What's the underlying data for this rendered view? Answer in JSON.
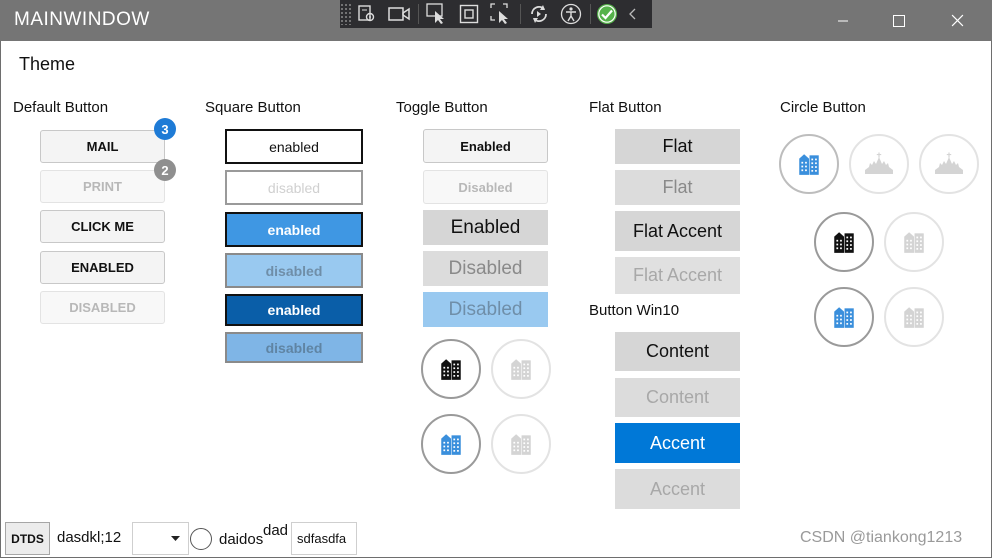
{
  "window": {
    "title": "MAINWINDOW",
    "controls": {
      "minimize": "—",
      "maximize": "☐",
      "close": "✕"
    }
  },
  "toolbar_icons": [
    "live-visual-tree-icon",
    "video-icon",
    "select-element-icon",
    "display-layout-adorners-icon",
    "track-focus-icon",
    "hot-reload-icon",
    "accessibility-icon",
    "binding-success-icon",
    "collapse-icon"
  ],
  "page": {
    "heading": "Theme"
  },
  "default_buttons": {
    "title": "Default Button",
    "mail": "MAIL",
    "mail_badge": "3",
    "print": "PRINT",
    "print_badge": "2",
    "click_me": "CLICK ME",
    "enabled": "ENABLED",
    "disabled": "DISABLED"
  },
  "square_buttons": {
    "title": "Square Button",
    "items": [
      "enabled",
      "disabled",
      "enabled",
      "disabled",
      "enabled",
      "disabled"
    ]
  },
  "toggle_buttons": {
    "title": "Toggle Button",
    "items": [
      "Enabled",
      "Disabled",
      "Enabled",
      "Disabled",
      "Disabled"
    ]
  },
  "flat_buttons": {
    "title": "Flat Button",
    "items": [
      "Flat",
      "Flat",
      "Flat Accent",
      "Flat Accent"
    ]
  },
  "win10_buttons": {
    "title": "Button Win10",
    "items": [
      "Content",
      "Content",
      "Accent",
      "Accent"
    ]
  },
  "circle_buttons": {
    "title": "Circle Button"
  },
  "bottom_bar": {
    "dtds": "DTDS",
    "text": "dasdkl;12",
    "combo_value": "",
    "radio_label": "daidos",
    "superscript": "dad",
    "textbox_value": "sdfasdfa"
  },
  "watermark": "CSDN @tiankong1213",
  "colors": {
    "titlebar": "#757575",
    "accent": "#0078d7",
    "accent_light": "#3f97e3",
    "accent_dark": "#0a5ea8",
    "accent_pale": "#99c9f0",
    "badge_blue": "#1e7bd6",
    "badge_gray": "#8f8f8f",
    "flat_gray": "#d6d6d6",
    "icon_blue": "#3a8fdc"
  }
}
